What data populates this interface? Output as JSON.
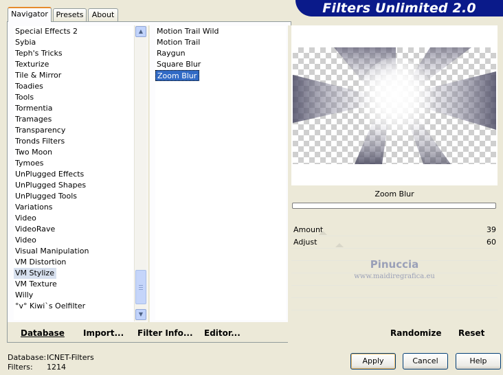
{
  "banner": {
    "title": "Filters Unlimited 2.0"
  },
  "tabs": [
    {
      "label": "Navigator",
      "active": true
    },
    {
      "label": "Presets",
      "active": false
    },
    {
      "label": "About",
      "active": false
    }
  ],
  "categories": {
    "items": [
      "Special Effects 2",
      "Sybia",
      "Teph's Tricks",
      "Texturize",
      "Tile & Mirror",
      "Toadies",
      "Tools",
      "Tormentia",
      "Tramages",
      "Transparency",
      "Tronds Filters",
      "Two Moon",
      "Tymoes",
      "UnPlugged Effects",
      "UnPlugged Shapes",
      "UnPlugged Tools",
      "Variations",
      "Video",
      "VideoRave",
      "Video",
      "Visual Manipulation",
      "VM Distortion",
      "VM Stylize",
      "VM Texture",
      "Willy",
      "°v° Kiwi`s Oelfilter"
    ],
    "selected": "VM Stylize"
  },
  "filters": {
    "items": [
      "Motion Trail Wild",
      "Motion Trail",
      "Raygun",
      "Square Blur",
      "Zoom Blur"
    ],
    "selected": "Zoom Blur"
  },
  "left_buttons": {
    "database": "Database",
    "import": "Import...",
    "filter_info": "Filter Info...",
    "editor": "Editor..."
  },
  "filter_name": "Zoom Blur",
  "params": [
    {
      "label": "Amount",
      "value": "39"
    },
    {
      "label": "Adjust",
      "value": "60"
    }
  ],
  "watermark": {
    "name": "Pinuccia",
    "url": "www.maidiregrafica.eu"
  },
  "right_buttons": {
    "randomize": "Randomize",
    "reset": "Reset"
  },
  "status": {
    "database_label": "Database:",
    "database_value": "ICNET-Filters",
    "filters_label": "Filters:",
    "filters_value": "1214"
  },
  "dialog_buttons": {
    "apply": "Apply",
    "cancel": "Cancel",
    "help": "Help"
  }
}
